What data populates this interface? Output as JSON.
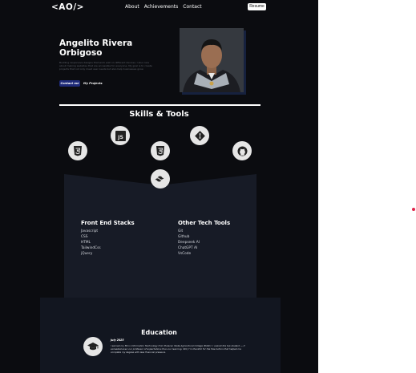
{
  "nav": {
    "logo": "<AO/>",
    "links": [
      "About",
      "Achievements",
      "Contact"
    ],
    "resume_label": "Resume"
  },
  "hero": {
    "name": "Angelito Rivera Orbigoso",
    "description": "Building responsive designs that work well on different devices. I also care about making websites that are accessible for everyone. My goal is to create projects that not only meet user needs but also help businesses grow.",
    "contact_label": "Contact me",
    "projects_label": "My Projects"
  },
  "skills": {
    "title": "Skills & Tools",
    "icons": [
      "html5-icon",
      "js-icon",
      "css3-icon",
      "git-icon",
      "github-icon",
      "tailwind-icon"
    ],
    "front_end": {
      "title": "Front End Stacks",
      "items": [
        "Javascript",
        "CSS",
        "HTML",
        "TailwindCss",
        "jQuery"
      ]
    },
    "other_tools": {
      "title": "Other Tech Tools",
      "items": [
        "Git",
        "Github",
        "Deepseek AI",
        "ChatGPT AI",
        "VsCode"
      ]
    }
  },
  "education": {
    "title": "Education",
    "date": "July 2025",
    "text": "I earned my BS in Information Technology from Bulacan State Agricultural College (BASC). I overall the top student — it exceeded even our professor of expectations than our learning. Still, I'm thankful for the free tuition that helped me complete my degree with less financial pressure."
  },
  "colors": {
    "page_bg": "#0b0c10",
    "panel_bg": "#171b26",
    "accent": "#1e2a78",
    "indicator": "#e0244a"
  }
}
